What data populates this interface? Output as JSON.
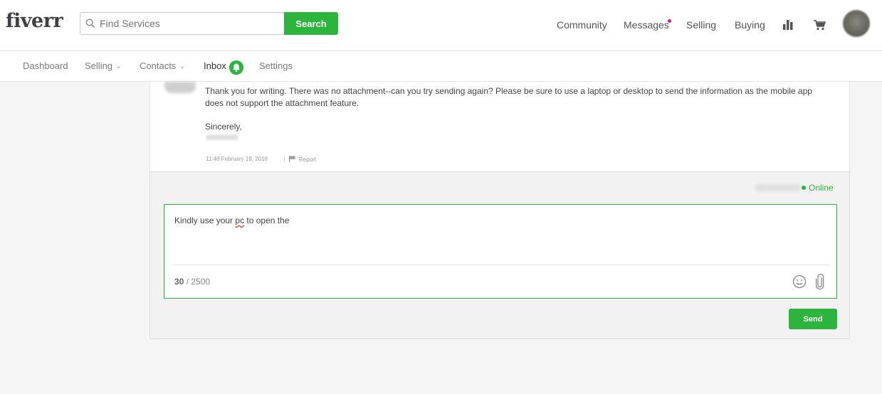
{
  "header": {
    "logo": "fiverr",
    "search": {
      "placeholder": "Find Services",
      "value": "",
      "button_label": "Search"
    },
    "nav": {
      "community": "Community",
      "messages": "Messages",
      "selling": "Selling",
      "buying": "Buying"
    },
    "icons": {
      "stats": "bar-chart-icon",
      "cart": "cart-icon"
    }
  },
  "subnav": {
    "items": [
      {
        "label": "Dashboard"
      },
      {
        "label": "Selling"
      },
      {
        "label": "Contacts"
      },
      {
        "label": "Inbox"
      },
      {
        "label": "Settings"
      }
    ]
  },
  "message": {
    "body": "Thank you for writing. There was no attachment--can you try sending again? Please be sure to use a laptop or desktop to send the information as the mobile app does not support the attachment feature.",
    "signoff": "Sincerely,",
    "timestamp": "11:48 February 19, 2018",
    "report_label": "Report"
  },
  "compose": {
    "status": "Online",
    "draft_before": "Kindly use your ",
    "draft_misspelled": "pc",
    "draft_after": " to open the",
    "char_count": "30",
    "char_limit": "/ 2500",
    "send_label": "Send"
  },
  "colors": {
    "accent": "#2bb53c",
    "notification_dot": "#e0157e"
  }
}
